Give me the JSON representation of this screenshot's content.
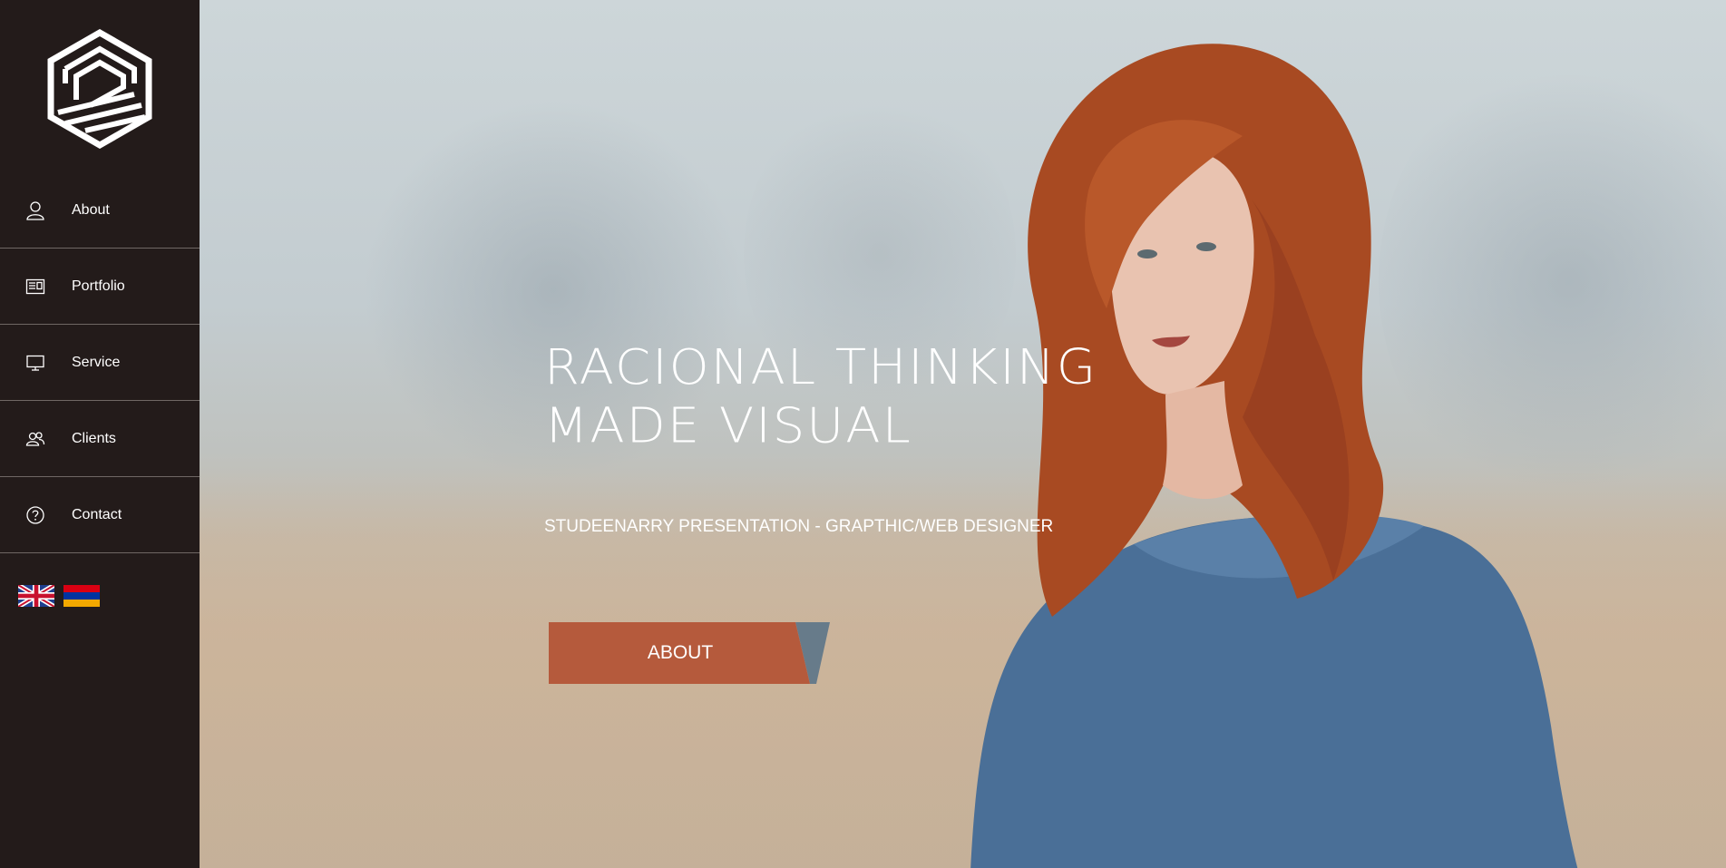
{
  "sidebar": {
    "logo_icon": "hexagon-logo-icon",
    "items": [
      {
        "label": "About",
        "icon": "user-icon"
      },
      {
        "label": "Portfolio",
        "icon": "portfolio-icon"
      },
      {
        "label": "Service",
        "icon": "monitor-icon"
      },
      {
        "label": "Clients",
        "icon": "users-icon"
      },
      {
        "label": "Contact",
        "icon": "question-icon"
      }
    ],
    "languages": [
      {
        "name": "English",
        "icon": "uk-flag-icon"
      },
      {
        "name": "Armenian",
        "icon": "armenia-flag-icon"
      }
    ]
  },
  "hero": {
    "headline_line1": "RACIONAL THINKING",
    "headline_line2": "MADE VISUAL",
    "subtitle": "STUDEENARRY PRESENTATION - GRAPTHIC/WEB DESIGNER",
    "cta_label": "ABOUT"
  },
  "colors": {
    "sidebar_bg": "#231b1a",
    "accent": "#b55a3c",
    "accent_secondary": "#677b8a"
  }
}
